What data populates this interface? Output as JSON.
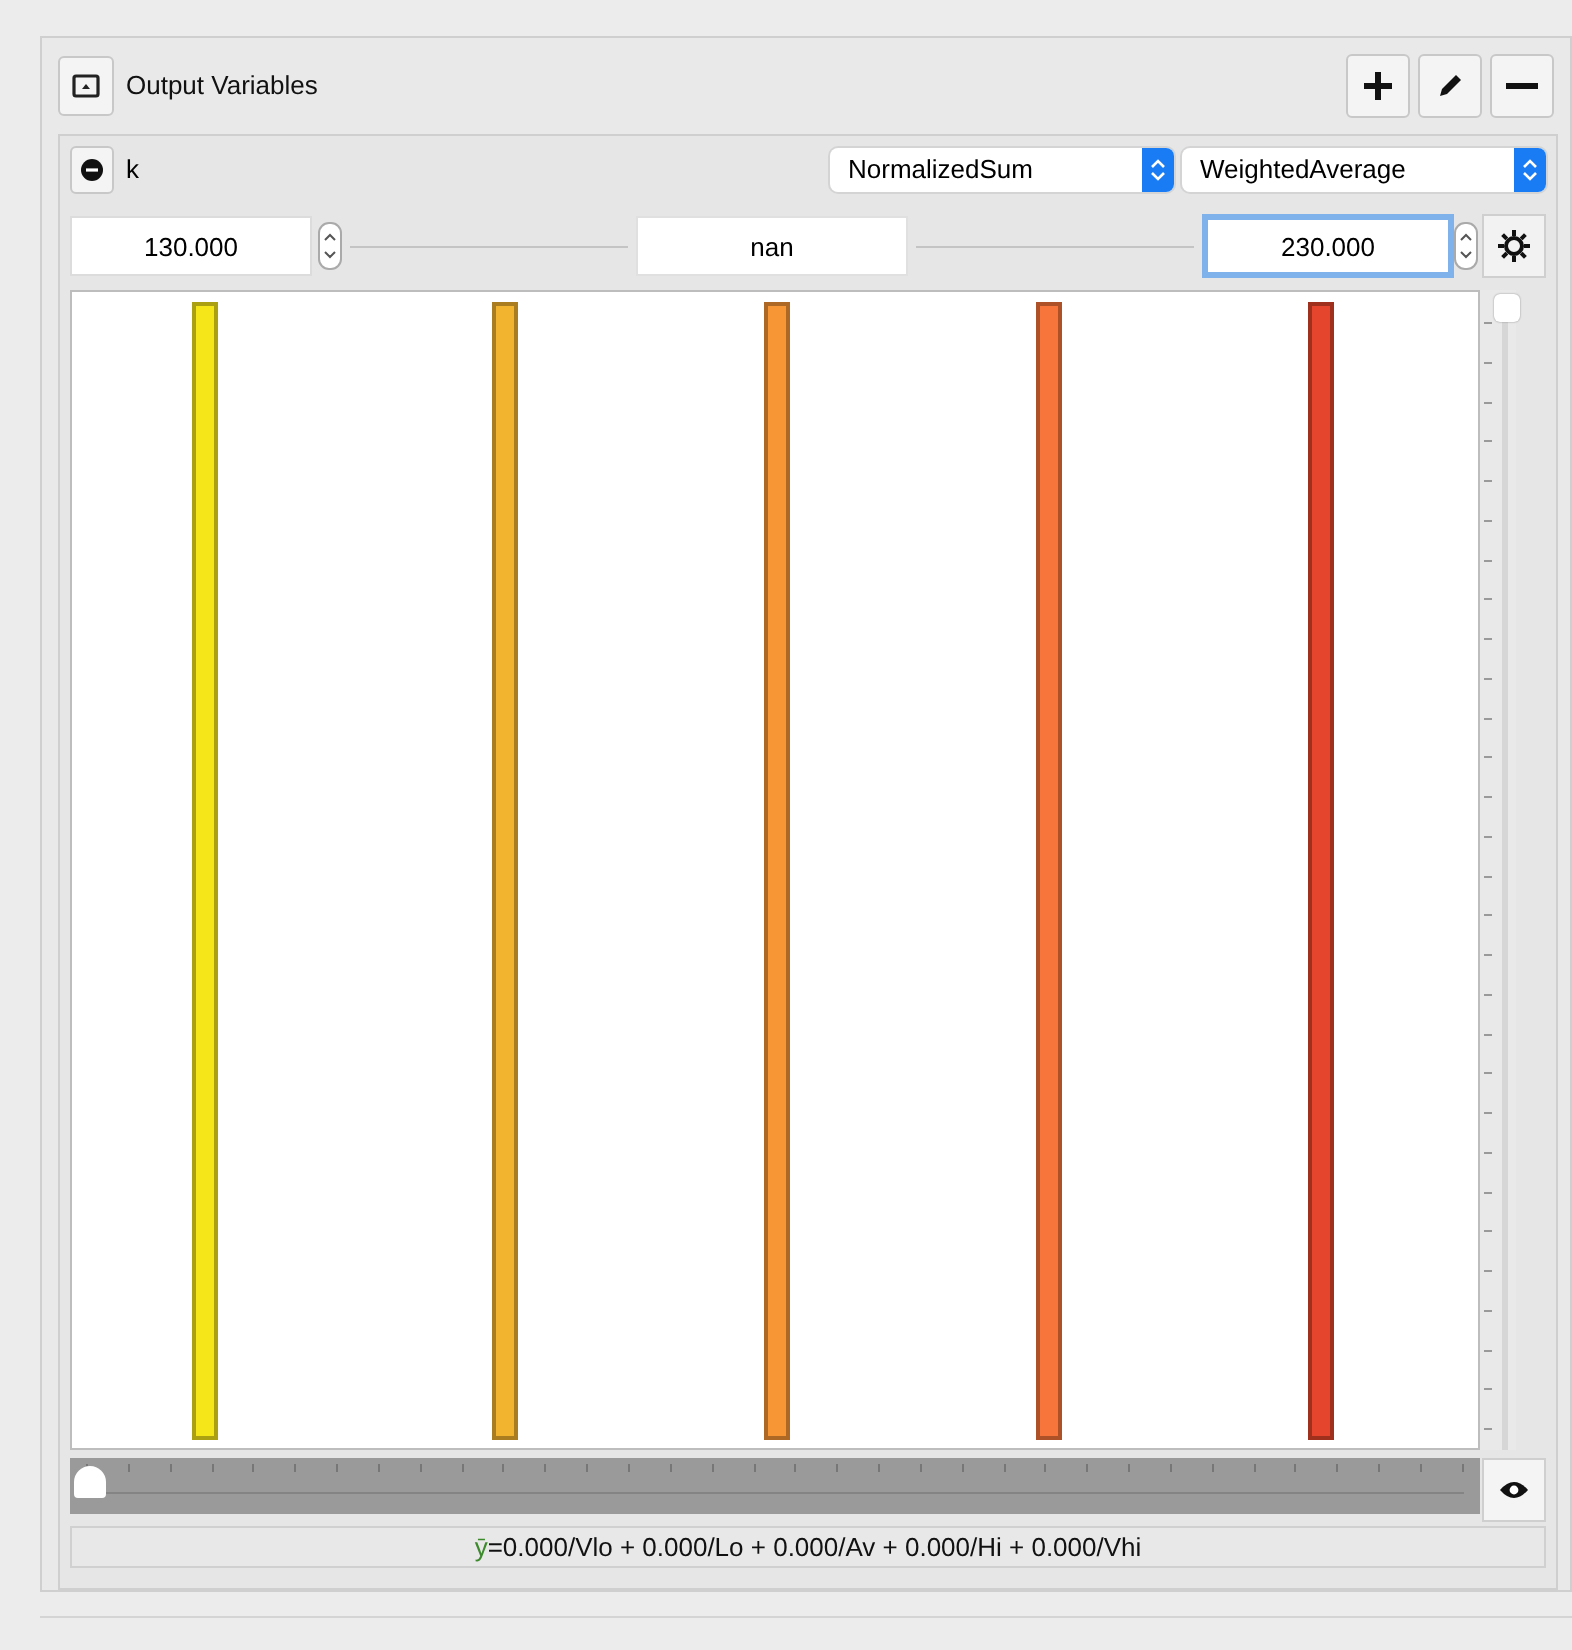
{
  "panel": {
    "title": "Output Variables",
    "buttons": [
      {
        "kind": "add"
      },
      {
        "kind": "edit"
      },
      {
        "kind": "remove"
      }
    ]
  },
  "variable": {
    "name": "k",
    "accumulation": "NormalizedSum",
    "defuzzifier": "WeightedAverage",
    "minimum": "130.000",
    "value": "nan",
    "maximum": "230.000",
    "maximum_focused": true
  },
  "terms": [
    {
      "color": "#f5e61a"
    },
    {
      "color": "#f2b32e"
    },
    {
      "color": "#f79634"
    },
    {
      "color": "#f7743a"
    },
    {
      "color": "#e5452c"
    }
  ],
  "vertical_slider": {
    "level": 1
  },
  "horizontal_slider": {
    "level": 0
  },
  "formula": {
    "symbol": "ȳ",
    "text": "=0.000/Vlo + 0.000/Lo + 0.000/Av + 0.000/Hi + 0.000/Vhi"
  }
}
